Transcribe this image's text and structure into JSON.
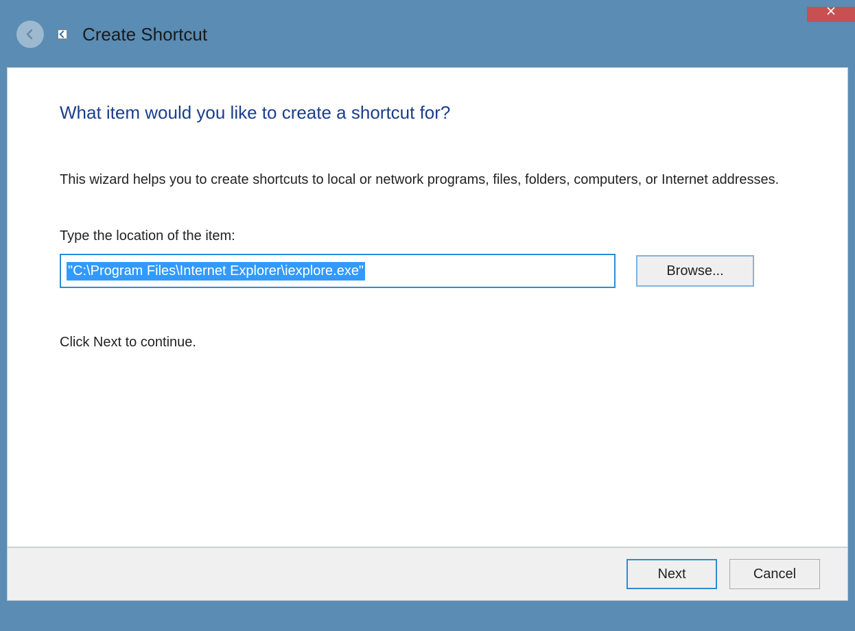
{
  "window": {
    "title": "Create Shortcut"
  },
  "main": {
    "heading": "What item would you like to create a shortcut for?",
    "description": "This wizard helps you to create shortcuts to local or network programs, files, folders, computers, or Internet addresses.",
    "field_label": "Type the location of the item:",
    "location_value": "\"C:\\Program Files\\Internet Explorer\\iexplore.exe\"",
    "browse_label": "Browse...",
    "continue_text": "Click Next to continue."
  },
  "footer": {
    "next_label": "Next",
    "cancel_label": "Cancel"
  }
}
